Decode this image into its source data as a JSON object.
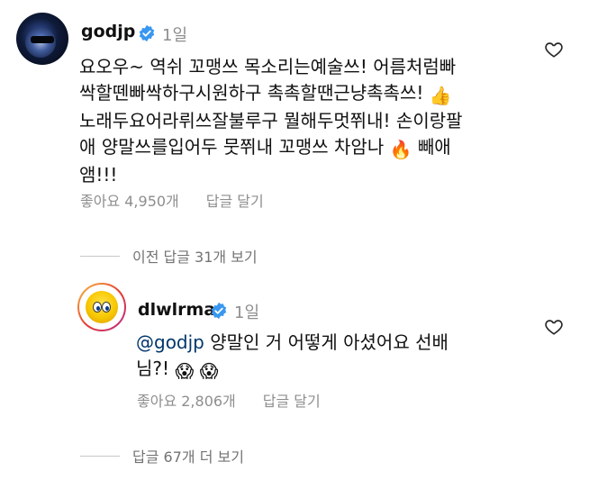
{
  "comments": [
    {
      "username": "godjp",
      "time": "1일",
      "lines": [
        "요오우~ 역쉬 꼬맹쓰 목소리는예술쓰! 어름처럼빠",
        "싹할뗀빠싹하구시원하구 촉촉할땐근냥촉촉쓰!",
        "노래두요어라뤼쓰잘불루구 뭘해두멋쮜내! 손이랑팔",
        "애 양말쓰를입어두 뭇쮜내 꼬맹쓰 차암나",
        "앰!!!"
      ],
      "line2_emoji": "👍",
      "line4_emoji": "🔥",
      "line4_tail": "빼애",
      "likes": "좋아요 4,950개",
      "reply_label": "답글 달기",
      "more_replies": "이전 답글 31개 보기"
    },
    {
      "username": "dlwlrma",
      "time": "1일",
      "mention": "@godjp",
      "line1": "양말인 거 어떻게 아셨어요 선배",
      "line2": "님?!",
      "emojis": "😱 😱",
      "likes": "좋아요 2,806개",
      "reply_label": "답글 달기",
      "more_replies": "답글 67개 더 보기"
    }
  ],
  "icons": {
    "verified": "verified-badge-icon",
    "like": "heart-icon"
  },
  "colors": {
    "verified": "#3897f0",
    "muted": "#8e8e8e",
    "mention": "#00376b"
  }
}
